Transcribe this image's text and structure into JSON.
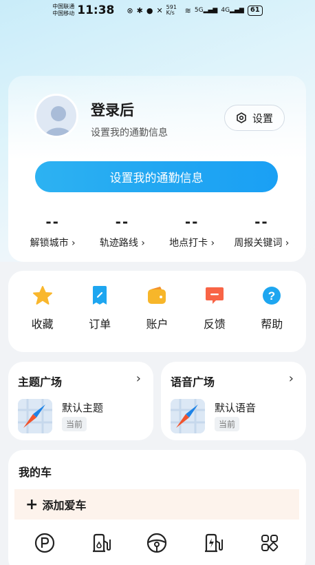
{
  "status_bar": {
    "carrier_1": "中国联通",
    "carrier_2": "中国移动",
    "time": "11:38",
    "net_speed": "591 K/s",
    "signal_1": "5G",
    "signal_2": "4G",
    "battery": "61"
  },
  "profile": {
    "name": "登录后",
    "subtitle": "设置我的通勤信息",
    "settings_label": "设置",
    "main_button": "设置我的通勤信息",
    "stats": [
      {
        "value": "--",
        "label": "解锁城市 ›"
      },
      {
        "value": "--",
        "label": "轨迹路线 ›"
      },
      {
        "value": "--",
        "label": "地点打卡 ›"
      },
      {
        "value": "--",
        "label": "周报关键词 ›"
      }
    ]
  },
  "actions": [
    {
      "label": "收藏",
      "icon": "star-icon",
      "color": "#f9b72d"
    },
    {
      "label": "订单",
      "icon": "order-icon",
      "color": "#1ea6f0"
    },
    {
      "label": "账户",
      "icon": "wallet-icon",
      "color": "#f7b62a"
    },
    {
      "label": "反馈",
      "icon": "feedback-icon",
      "color": "#f86446"
    },
    {
      "label": "帮助",
      "icon": "help-icon",
      "color": "#1ea6f0"
    }
  ],
  "theme_plaza": {
    "title": "主题广场",
    "item": "默认主题",
    "tag": "当前"
  },
  "voice_plaza": {
    "title": "语音广场",
    "item": "默认语音",
    "tag": "当前"
  },
  "my_car": {
    "title": "我的车",
    "add_label": "添加爱车",
    "icons": [
      "parking-icon",
      "gas-station-icon",
      "steering-wheel-icon",
      "charging-station-icon",
      "more-apps-icon"
    ]
  },
  "colors": {
    "accent": "#22a7f2",
    "background": "#f1f3f6"
  }
}
